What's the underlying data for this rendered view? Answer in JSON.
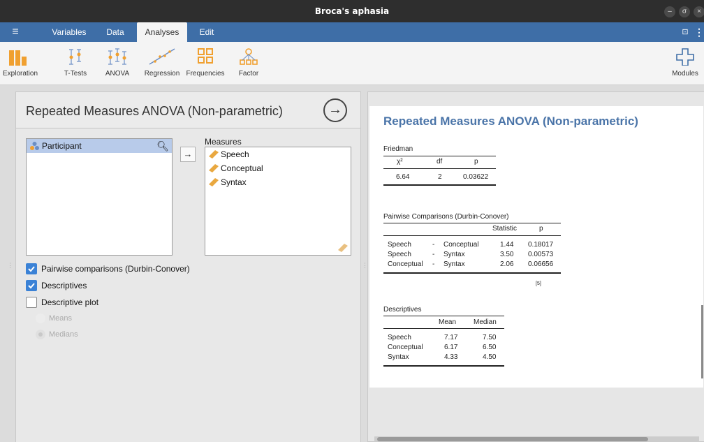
{
  "window": {
    "title": "Broca's aphasia"
  },
  "menubar": {
    "tabs": [
      "Variables",
      "Data",
      "Analyses",
      "Edit"
    ],
    "active": "Analyses"
  },
  "ribbon": {
    "items": [
      "Exploration",
      "T-Tests",
      "ANOVA",
      "Regression",
      "Frequencies",
      "Factor"
    ],
    "modules": "Modules"
  },
  "options": {
    "title": "Repeated Measures ANOVA (Non-parametric)",
    "source_vars": [
      "Participant"
    ],
    "measures_label": "Measures",
    "measures": [
      "Speech",
      "Conceptual",
      "Syntax"
    ],
    "checkboxes": [
      {
        "label": "Pairwise comparisons (Durbin-Conover)",
        "checked": true
      },
      {
        "label": "Descriptives",
        "checked": true
      },
      {
        "label": "Descriptive plot",
        "checked": false
      }
    ],
    "radios": [
      "Means",
      "Medians"
    ]
  },
  "results": {
    "title": "Repeated Measures ANOVA (Non-parametric)",
    "friedman": {
      "caption": "Friedman",
      "headers": [
        "χ²",
        "df",
        "p"
      ],
      "row": [
        "6.64",
        "2",
        "0.03622"
      ]
    },
    "pairwise": {
      "caption": "Pairwise Comparisons (Durbin-Conover)",
      "headers": [
        "Statistic",
        "p"
      ],
      "rows": [
        [
          "Speech",
          "-",
          "Conceptual",
          "1.44",
          "0.18017"
        ],
        [
          "Speech",
          "-",
          "Syntax",
          "3.50",
          "0.00573"
        ],
        [
          "Conceptual",
          "-",
          "Syntax",
          "2.06",
          "0.06656"
        ]
      ],
      "ref": "[5]"
    },
    "descriptives": {
      "caption": "Descriptives",
      "headers": [
        "Mean",
        "Median"
      ],
      "rows": [
        [
          "Speech",
          "7.17",
          "7.50"
        ],
        [
          "Conceptual",
          "6.17",
          "6.50"
        ],
        [
          "Syntax",
          "4.33",
          "4.50"
        ]
      ]
    }
  }
}
